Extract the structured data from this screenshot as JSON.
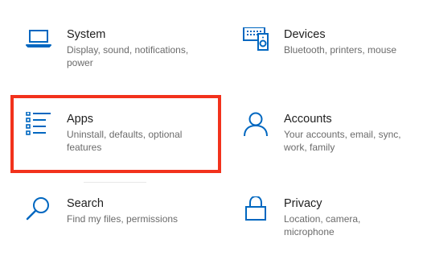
{
  "accent_color": "#0067c0",
  "highlight_color": "#f2321c",
  "tiles": [
    {
      "icon": "laptop-icon",
      "title": "System",
      "description": "Display, sound, notifications, power"
    },
    {
      "icon": "devices-icon",
      "title": "Devices",
      "description": "Bluetooth, printers, mouse"
    },
    {
      "icon": "apps-list-icon",
      "title": "Apps",
      "description": "Uninstall, defaults, optional features"
    },
    {
      "icon": "person-icon",
      "title": "Accounts",
      "description": "Your accounts, email, sync, work, family"
    },
    {
      "icon": "search-icon",
      "title": "Search",
      "description": "Find my files, permissions"
    },
    {
      "icon": "lock-icon",
      "title": "Privacy",
      "description": "Location, camera, microphone"
    }
  ]
}
